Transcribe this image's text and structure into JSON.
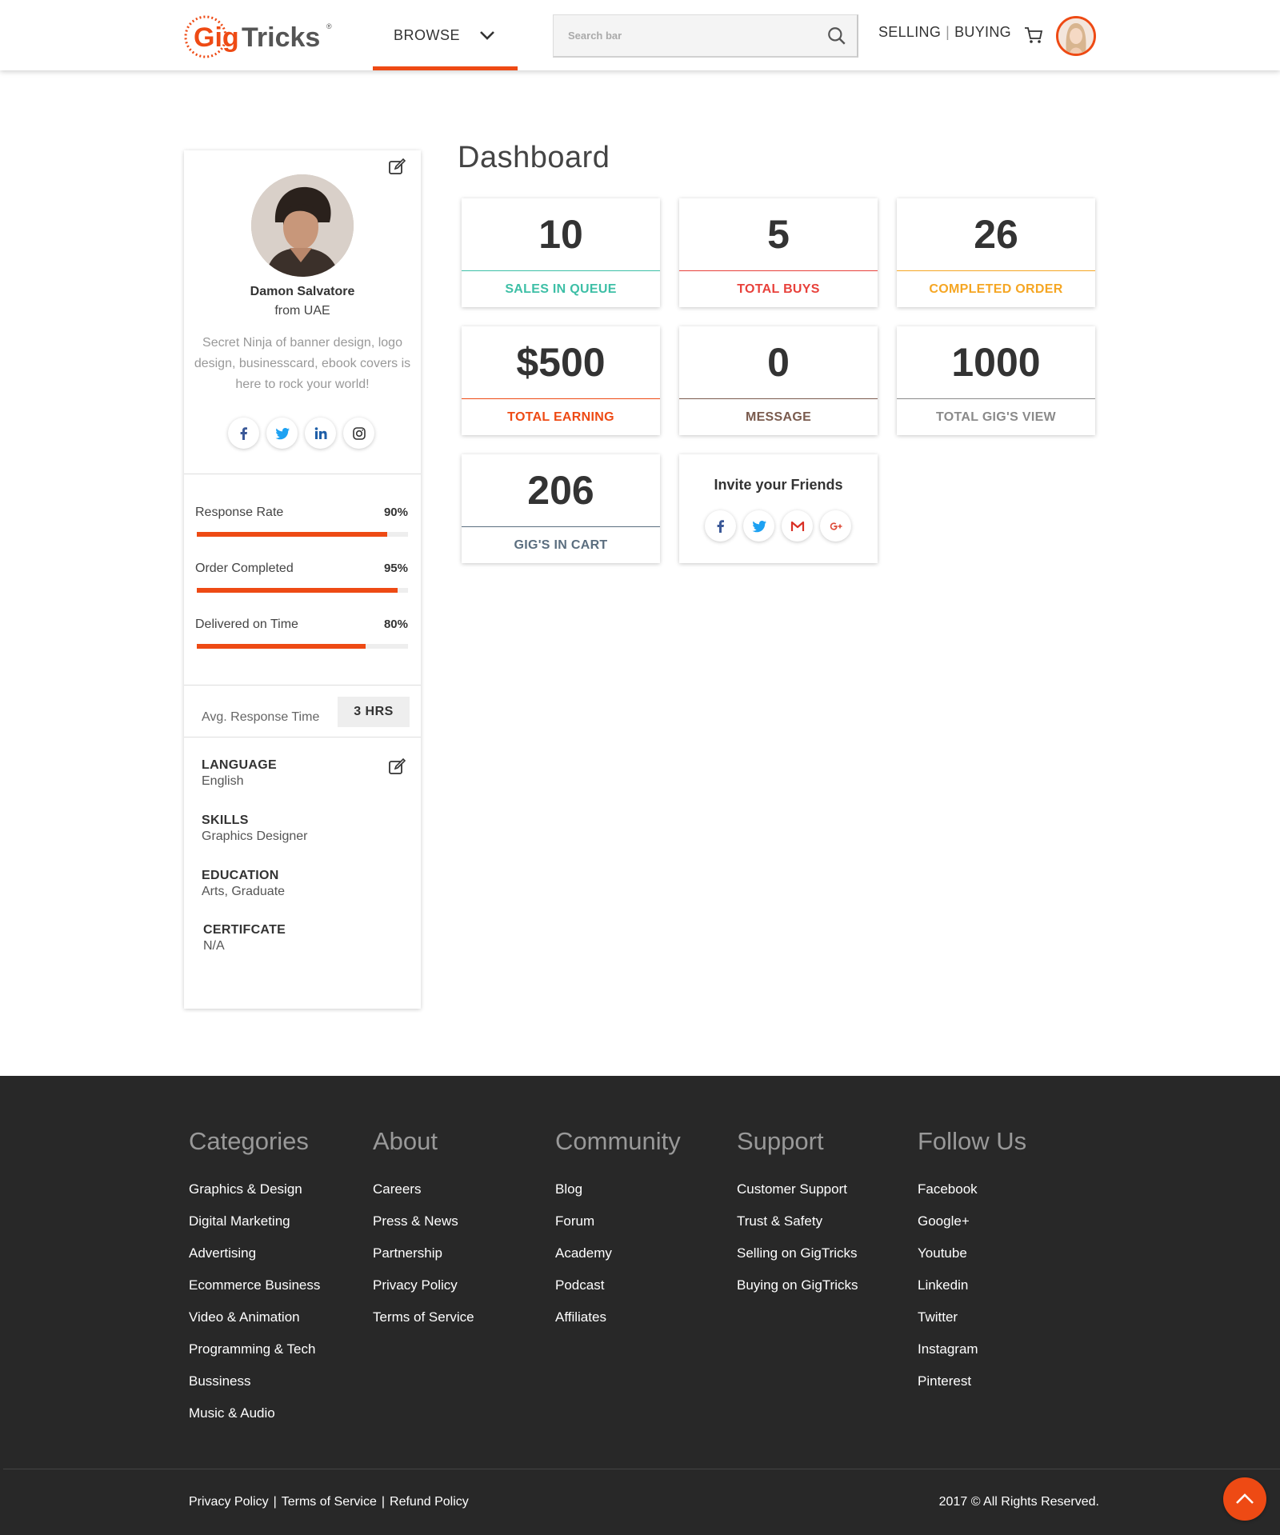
{
  "header": {
    "logo": "GigTricks",
    "browse_label": "BROWSE",
    "search_placeholder": "Search bar",
    "selling_label": "SELLING",
    "buying_label": "BUYING",
    "accent_color": "#ee4a14"
  },
  "profile": {
    "name": "Damon Salvatore",
    "from": "from UAE",
    "bio": "Secret Ninja of banner design, logo design, businesscard, ebook covers is here to rock your world!",
    "socials": [
      "facebook-icon",
      "twitter-icon",
      "linkedin-icon",
      "instagram-icon"
    ],
    "stats": [
      {
        "label": "Response Rate",
        "value": "90%",
        "fraction": 0.9
      },
      {
        "label": "Order Completed",
        "value": "95%",
        "fraction": 0.95
      },
      {
        "label": "Delivered on Time",
        "value": "80%",
        "fraction": 0.8
      }
    ],
    "avg_response_label": "Avg. Response Time",
    "avg_response_value": "3 HRS",
    "info": [
      {
        "heading": "LANGUAGE",
        "value": "English"
      },
      {
        "heading": "SKILLS",
        "value": "Graphics Designer"
      },
      {
        "heading": "EDUCATION",
        "value": "Arts, Graduate"
      },
      {
        "heading": "CERTIFCATE",
        "value": "N/A"
      }
    ]
  },
  "dashboard": {
    "title": "Dashboard",
    "tiles": [
      {
        "value": "10",
        "caption": "SALES IN QUEUE",
        "color": "#3dbfa6"
      },
      {
        "value": "5",
        "caption": "TOTAL BUYS",
        "color": "#e8413b"
      },
      {
        "value": "26",
        "caption": "COMPLETED ORDER",
        "color": "#f5a623"
      },
      {
        "value": "$500",
        "caption": "TOTAL EARNING",
        "color": "#ee4a14"
      },
      {
        "value": "0",
        "caption": "MESSAGE",
        "color": "#7a5b4e"
      },
      {
        "value": "1000",
        "caption": "TOTAL GIG'S VIEW",
        "color": "#8a8a8a"
      },
      {
        "value": "206",
        "caption": "GIG'S IN CART",
        "color": "#5b6e7f"
      }
    ],
    "invite": {
      "title": "Invite your Friends",
      "socials": [
        "facebook-icon",
        "twitter-icon",
        "gmail-icon",
        "google-plus-icon"
      ]
    }
  },
  "footer": {
    "columns": [
      {
        "title": "Categories",
        "items": [
          "Graphics & Design",
          "Digital Marketing",
          "Advertising",
          "Ecommerce Business",
          "Video & Animation",
          "Programming & Tech",
          "Bussiness",
          "Music & Audio"
        ]
      },
      {
        "title": "About",
        "items": [
          "Careers",
          "Press & News",
          "Partnership",
          "Privacy Policy",
          "Terms of Service"
        ]
      },
      {
        "title": "Community",
        "items": [
          "Blog",
          "Forum",
          "Academy",
          "Podcast",
          "Affiliates"
        ]
      },
      {
        "title": "Support",
        "items": [
          "Customer Support",
          "Trust & Safety",
          "Selling on GigTricks",
          "Buying on GigTricks"
        ]
      },
      {
        "title": "Follow Us",
        "items": [
          "Facebook",
          "Google+",
          "Youtube",
          "Linkedin",
          "Twitter",
          "Instagram",
          "Pinterest"
        ]
      }
    ],
    "legal": [
      "Privacy Policy",
      "Terms of Service",
      "Refund Policy"
    ],
    "copyright": "2017 © All Rights Reserved."
  }
}
